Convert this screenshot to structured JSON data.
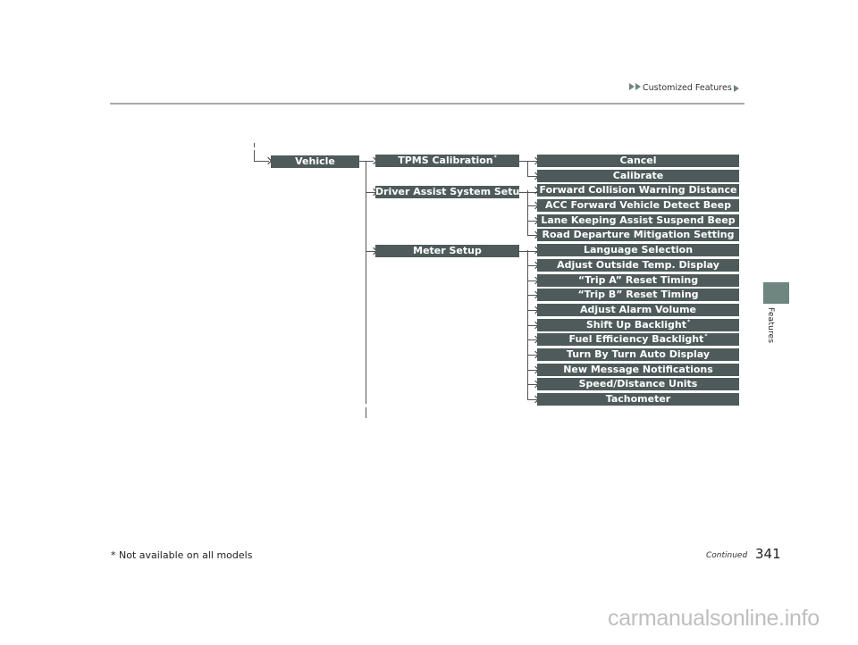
{
  "header": {
    "breadcrumb": "Customized Features",
    "breadcrumb_icon": "double-triangle-right-icon"
  },
  "side_tab": {
    "label": "Features",
    "color": "#6f8580"
  },
  "menu": {
    "root": "Vehicle",
    "groups": [
      {
        "label": "TPMS Calibration",
        "note": "*",
        "items": [
          {
            "label": "Cancel",
            "note": ""
          },
          {
            "label": "Calibrate",
            "note": ""
          }
        ]
      },
      {
        "label": "Driver Assist System Setup",
        "note": "*",
        "items": [
          {
            "label": "Forward Collision Warning Distance",
            "note": ""
          },
          {
            "label": "ACC Forward Vehicle Detect Beep",
            "note": ""
          },
          {
            "label": "Lane Keeping Assist Suspend Beep",
            "note": ""
          },
          {
            "label": "Road Departure Mitigation Setting",
            "note": ""
          }
        ]
      },
      {
        "label": "Meter Setup",
        "note": "",
        "items": [
          {
            "label": "Language Selection",
            "note": ""
          },
          {
            "label": "Adjust Outside Temp. Display",
            "note": ""
          },
          {
            "label": "“Trip A” Reset Timing",
            "note": ""
          },
          {
            "label": "“Trip B” Reset Timing",
            "note": ""
          },
          {
            "label": "Adjust Alarm Volume",
            "note": ""
          },
          {
            "label": "Shift Up Backlight",
            "note": "*"
          },
          {
            "label": "Fuel Efficiency Backlight",
            "note": "*"
          },
          {
            "label": "Turn By Turn Auto Display",
            "note": ""
          },
          {
            "label": "New Message Notifications",
            "note": ""
          },
          {
            "label": "Speed/Distance Units",
            "note": ""
          },
          {
            "label": "Tachometer",
            "note": ""
          }
        ]
      }
    ],
    "box_color": "#4e5b5a"
  },
  "footer": {
    "footnote": "* Not available on all models",
    "continued": "Continued",
    "page_number": "341"
  },
  "watermark": "carmanualsonline.info"
}
